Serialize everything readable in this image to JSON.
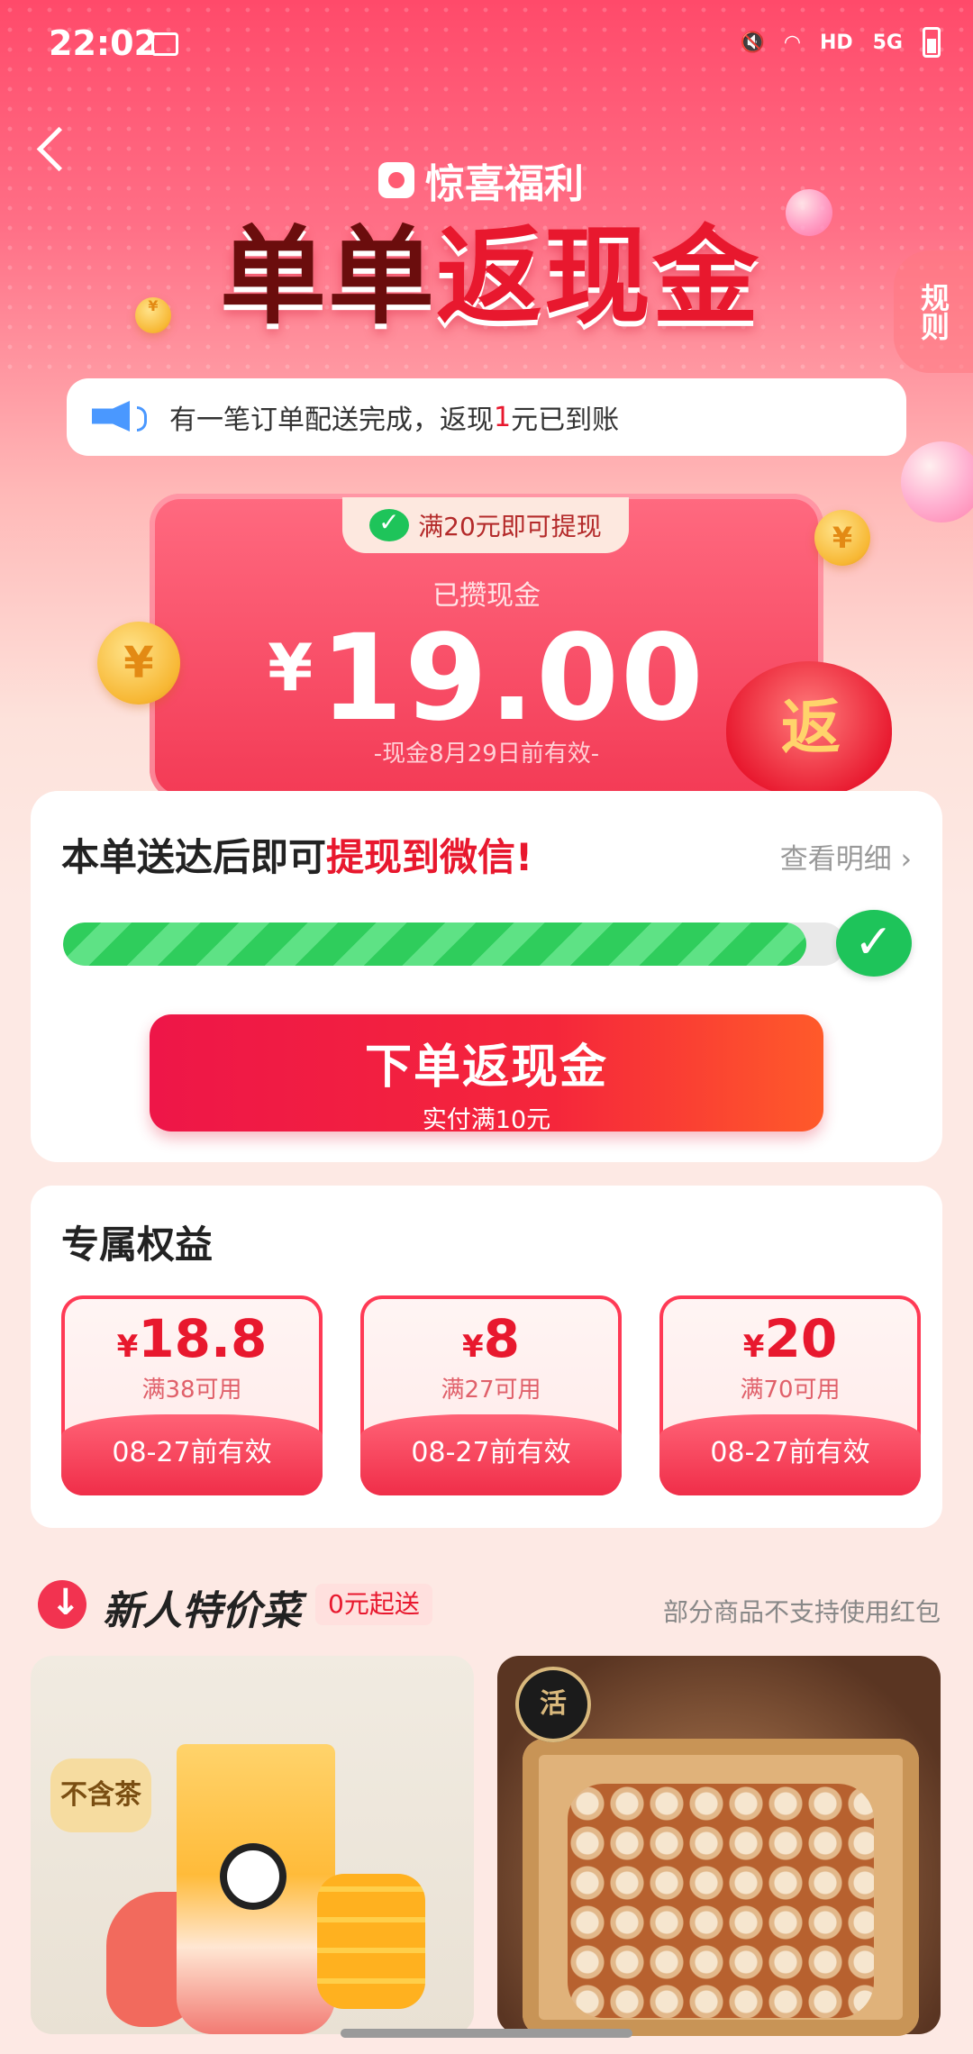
{
  "status_bar": {
    "time": "22:02",
    "network": "HD",
    "signal": "5G"
  },
  "header": {
    "brand": "惊喜福利",
    "title_dark": "单单",
    "title_red": "返现金",
    "rules": "规则"
  },
  "notice": {
    "pre": "有一笔订单配送完成，返现",
    "highlight": "1",
    "post": "元已到账"
  },
  "cash_card": {
    "tag": "满20元即可提现",
    "label": "已攒现金",
    "currency": "¥",
    "amount": "19.00",
    "expiry": "-现金8月29日前有效-",
    "bag_label": "返"
  },
  "progress": {
    "title_pre": "本单送达后即可",
    "title_red": "提现到微信!",
    "detail": "查看明细",
    "fill_fraction": 0.95,
    "button_main": "下单返现金",
    "button_sub": "实付满10元"
  },
  "benefits": {
    "title": "专属权益",
    "coupons": [
      {
        "currency": "¥",
        "amount": "18.8",
        "condition": "满38可用",
        "valid": "08-27前有效"
      },
      {
        "currency": "¥",
        "amount": "8",
        "condition": "满27可用",
        "valid": "08-27前有效"
      },
      {
        "currency": "¥",
        "amount": "20",
        "condition": "满70可用",
        "valid": "08-27前有效"
      }
    ]
  },
  "new_user": {
    "title": "新人特价菜",
    "badge": "0元起送",
    "note": "部分商品不支持使用红包",
    "product1_badge": "不含茶",
    "product2_brand": "活"
  },
  "colors": {
    "accent": "#e8182e",
    "wechat": "#1ec45a",
    "hero": "#ff4a6a"
  }
}
